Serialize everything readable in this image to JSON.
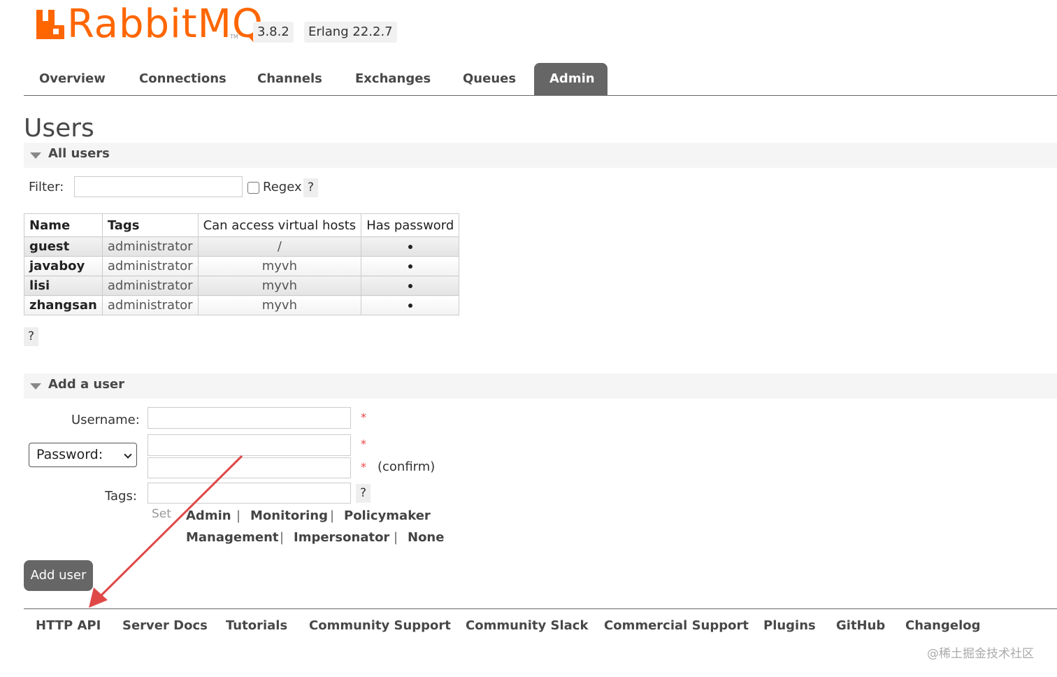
{
  "header": {
    "logo_text": "RabbitMQ",
    "logo_tm": "TM",
    "version": "3.8.2",
    "erlang": "Erlang 22.2.7",
    "brand_color": "#ff6600"
  },
  "tabs": [
    {
      "label": "Overview"
    },
    {
      "label": "Connections"
    },
    {
      "label": "Channels"
    },
    {
      "label": "Exchanges"
    },
    {
      "label": "Queues"
    },
    {
      "label": "Admin",
      "active": true
    }
  ],
  "page": {
    "title": "Users"
  },
  "all_users": {
    "section_label": "All users",
    "filter_label": "Filter:",
    "filter_value": "",
    "regex_label": "Regex",
    "help_label": "?",
    "columns": [
      "Name",
      "Tags",
      "Can access virtual hosts",
      "Has password"
    ],
    "rows": [
      {
        "name": "guest",
        "tags": "administrator",
        "vhosts": "/",
        "has_password": true
      },
      {
        "name": "javaboy",
        "tags": "administrator",
        "vhosts": "myvh",
        "has_password": true
      },
      {
        "name": "lisi",
        "tags": "administrator",
        "vhosts": "myvh",
        "has_password": true
      },
      {
        "name": "zhangsan",
        "tags": "administrator",
        "vhosts": "myvh",
        "has_password": true
      }
    ],
    "table_help": "?"
  },
  "add_user": {
    "section_label": "Add a user",
    "username_label": "Username:",
    "password_select": "Password:",
    "required_mark": "*",
    "confirm_label": "(confirm)",
    "tags_label": "Tags:",
    "tags_help": "?",
    "set_label": "Set",
    "separator": "|",
    "tag_options_row1": [
      "Admin",
      "Monitoring",
      "Policymaker"
    ],
    "tag_options_row2": [
      "Management",
      "Impersonator",
      "None"
    ],
    "submit_label": "Add user"
  },
  "footer": {
    "links": [
      "HTTP API",
      "Server Docs",
      "Tutorials",
      "Community Support",
      "Community Slack",
      "Commercial Support",
      "Plugins",
      "GitHub",
      "Changelog"
    ]
  },
  "watermark": "@稀土掘金技术社区",
  "annotation": {
    "color": "#e04848",
    "type": "arrow"
  }
}
